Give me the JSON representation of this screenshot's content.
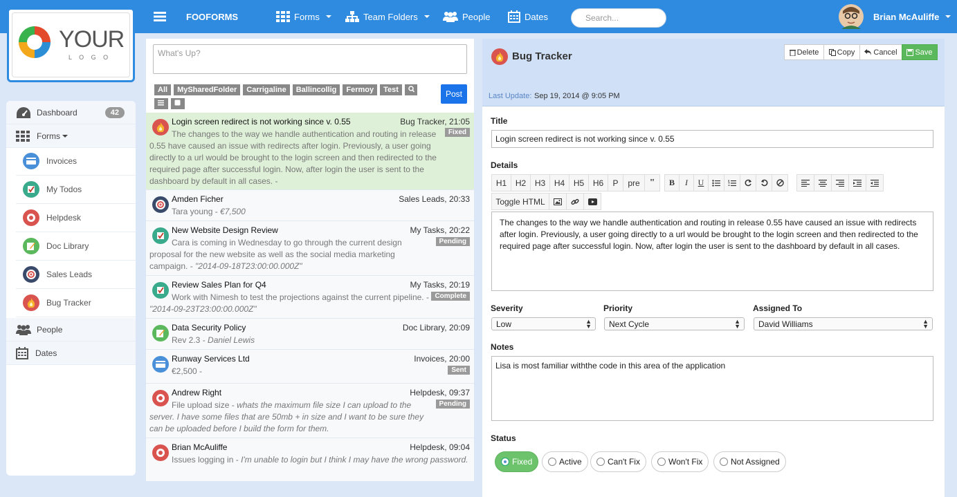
{
  "header": {
    "brand": "FOOFORMS",
    "nav": [
      {
        "label": "Forms",
        "icon": "grid-icon"
      },
      {
        "label": "Team Folders",
        "icon": "sitemap-icon"
      },
      {
        "label": "People",
        "icon": "people-icon"
      },
      {
        "label": "Dates",
        "icon": "calendar-icon"
      }
    ],
    "search_placeholder": "Search...",
    "user_name": "Brian McAuliffe"
  },
  "logo": {
    "text_main": "YOUR",
    "text_sub": "L O G O"
  },
  "sidebar": {
    "items": [
      {
        "label": "Dashboard",
        "badge": "42",
        "icon": "dashboard-icon"
      },
      {
        "label": "Forms",
        "icon": "grid-icon"
      },
      {
        "label": "People",
        "icon": "people-icon"
      },
      {
        "label": "Dates",
        "icon": "calendar-icon"
      }
    ],
    "forms": [
      {
        "label": "Invoices",
        "icon": "card-icon",
        "color": "#4a90d9"
      },
      {
        "label": "My Todos",
        "icon": "checkbox-icon",
        "color": "#3aaa8c"
      },
      {
        "label": "Helpdesk",
        "icon": "lifebuoy-icon",
        "color": "#d9534f"
      },
      {
        "label": "Doc Library",
        "icon": "edit-icon",
        "color": "#5cb85c"
      },
      {
        "label": "Sales Leads",
        "icon": "target-icon",
        "color": "#3a4a6b"
      },
      {
        "label": "Bug Tracker",
        "icon": "flame-icon",
        "color": "#d9534f"
      }
    ]
  },
  "feed": {
    "compose_placeholder": "What's Up?",
    "tags": [
      "All",
      "MySharedFolder",
      "Carrigaline",
      "Ballincollig",
      "Fermoy",
      "Test"
    ],
    "post_label": "Post",
    "items": [
      {
        "title": "Login screen redirect is not working since v. 0.55",
        "meta": "Bug Tracker, 21:05",
        "body": "The changes to the way we handle authentication and routing in release 0.55 have caused an issue with redirects after login. Previously, a user going directly to a url would be brought to the login screen and then redirected to the required page after successful login. Now, after login the user is sent to the dashboard by default in all cases. -",
        "italic": "",
        "status": "Fixed",
        "icon": "flame-icon"
      },
      {
        "title": "Amden Ficher",
        "meta": "Sales Leads, 20:33",
        "body": "Tara young -",
        "italic": "€7,500",
        "status": "",
        "icon": "target-icon"
      },
      {
        "title": "New Website Design Review",
        "meta": "My Tasks, 20:22",
        "body": "Cara is coming in Wednesday to go through the current design proposal for the new website as well as the social media marketing campaign. -",
        "italic": "\"2014-09-18T23:00:00.000Z\"",
        "status": "Pending",
        "icon": "checkbox-icon"
      },
      {
        "title": "Review Sales Plan for Q4",
        "meta": "My Tasks, 20:19",
        "body": "Work with Nimesh to test the projections against the current pipeline. -",
        "italic": "\"2014-09-23T23:00:00.000Z\"",
        "status": "Complete",
        "icon": "checkbox-icon"
      },
      {
        "title": "Data Security Policy",
        "meta": "Doc Library, 20:09",
        "body": "Rev 2.3 -",
        "italic": "Daniel Lewis",
        "status": "",
        "icon": "edit-icon"
      },
      {
        "title": "Runway Services Ltd",
        "meta": "Invoices, 20:00",
        "body": "€2,500 -",
        "italic": "",
        "status": "Sent",
        "icon": "card-icon"
      },
      {
        "title": "Andrew Right",
        "meta": "Helpdesk, 09:37",
        "body": "File upload size -",
        "italic": "whats the maximum file size I can upload to the server. I have some files that are 50mb + in size and I want to be sure they can be uploaded before I build the form for them.",
        "status": "Pending",
        "icon": "lifebuoy-icon"
      },
      {
        "title": "Brian McAuliffe",
        "meta": "Helpdesk, 09:04",
        "body": "Issues logging in -",
        "italic": "I'm unable to login but I think I may have the wrong password.",
        "status": "",
        "icon": "lifebuoy-icon"
      }
    ]
  },
  "detail": {
    "form_name": "Bug Tracker",
    "actions": {
      "delete": "Delete",
      "copy": "Copy",
      "cancel": "Cancel",
      "save": "Save"
    },
    "last_update_label": "Last Update:",
    "last_update_value": "Sep 19, 2014 @ 9:05 PM",
    "title_label": "Title",
    "title_value": "Login screen redirect is not working since v. 0.55",
    "details_label": "Details",
    "toolbar": [
      "H1",
      "H2",
      "H3",
      "H4",
      "H5",
      "H6",
      "P",
      "pre"
    ],
    "toggle_html": "Toggle HTML",
    "details_value": "The changes to the way we handle authentication and routing in release 0.55 have caused an issue with redirects after login. Previously, a user going directly to a url would be brought to the login screen and then redirected to the required page after successful login. Now, after login the user is sent to the dashboard by default in all cases.",
    "severity_label": "Severity",
    "severity_value": "Low",
    "priority_label": "Priority",
    "priority_value": "Next Cycle",
    "assigned_label": "Assigned To",
    "assigned_value": "David Williams",
    "notes_label": "Notes",
    "notes_value": "Lisa is most familiar withthe code in this area of the application",
    "status_label": "Status",
    "status_options": [
      "Fixed",
      "Active",
      "Can't Fix",
      "Won't Fix",
      "Not Assigned"
    ],
    "status_selected": "Fixed"
  }
}
